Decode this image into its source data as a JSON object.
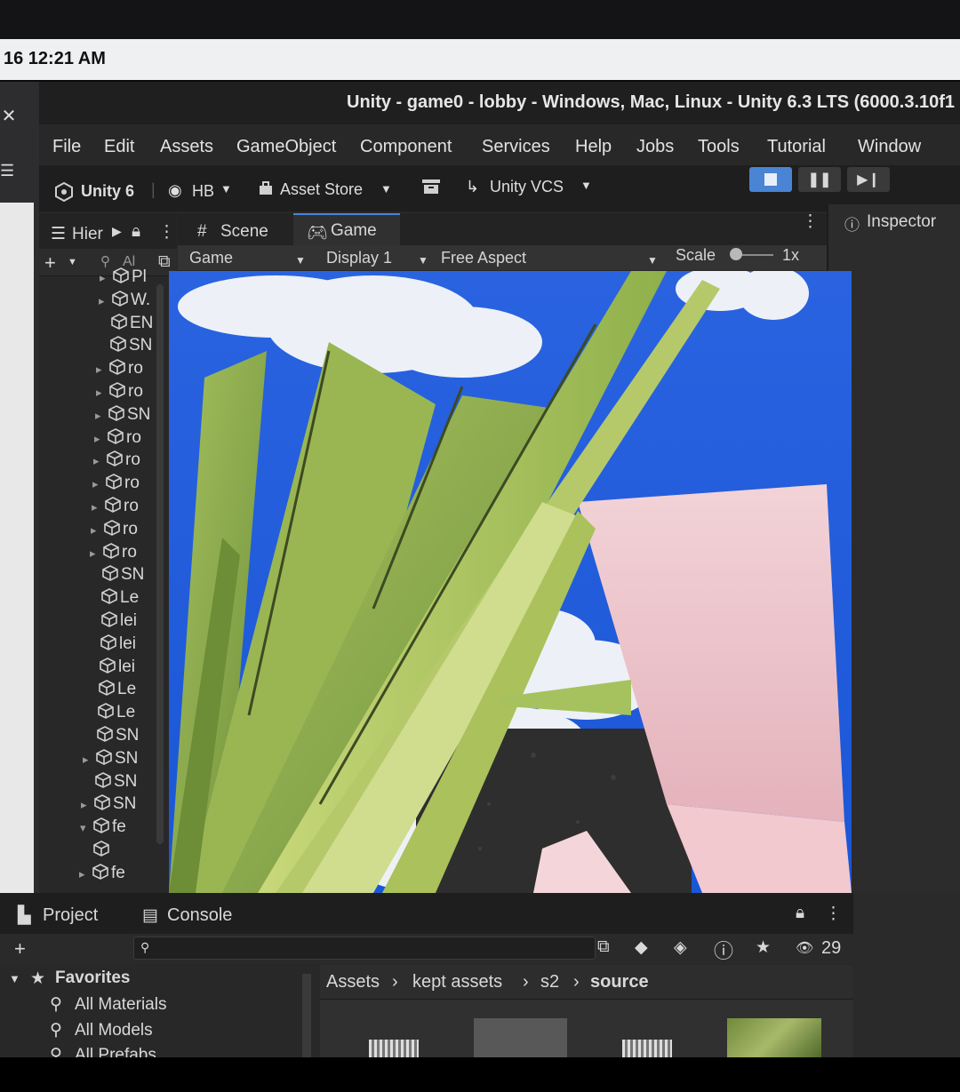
{
  "system": {
    "time": "16  12:21 AM"
  },
  "window": {
    "title": "Unity - game0 - lobby - Windows, Mac, Linux - Unity 6.3 LTS (6000.3.10f1"
  },
  "menu": [
    "File",
    "Edit",
    "Assets",
    "GameObject",
    "Component",
    "Services",
    "Help",
    "Jobs",
    "Tools",
    "Tutorial",
    "Window"
  ],
  "toolbar": {
    "unity_label": "Unity 6",
    "account_label": "HB",
    "asset_store_label": "Asset Store",
    "vcs_label": "Unity VCS"
  },
  "hierarchy": {
    "tab_label": "Hier",
    "search_placeholder": "Al",
    "rows": [
      {
        "label": "Pl",
        "expand": "▸"
      },
      {
        "label": "W.",
        "expand": "▸"
      },
      {
        "label": "EN",
        "expand": ""
      },
      {
        "label": "SN",
        "expand": ""
      },
      {
        "label": "ro",
        "expand": "▸"
      },
      {
        "label": "ro",
        "expand": "▸"
      },
      {
        "label": "SN",
        "expand": "▸"
      },
      {
        "label": "ro",
        "expand": "▸"
      },
      {
        "label": "ro",
        "expand": "▸"
      },
      {
        "label": "ro",
        "expand": "▸"
      },
      {
        "label": "ro",
        "expand": "▸"
      },
      {
        "label": "ro",
        "expand": "▸"
      },
      {
        "label": "ro",
        "expand": "▸"
      },
      {
        "label": "SN",
        "expand": ""
      },
      {
        "label": "Le",
        "expand": ""
      },
      {
        "label": "lei",
        "expand": ""
      },
      {
        "label": "lei",
        "expand": ""
      },
      {
        "label": "lei",
        "expand": ""
      },
      {
        "label": "Le",
        "expand": ""
      },
      {
        "label": "Le",
        "expand": ""
      },
      {
        "label": "SN",
        "expand": ""
      },
      {
        "label": "SN",
        "expand": "▸"
      },
      {
        "label": "SN",
        "expand": ""
      },
      {
        "label": "SN",
        "expand": "▸"
      },
      {
        "label": "fe",
        "expand": "▾"
      },
      {
        "label": "",
        "expand": ""
      },
      {
        "label": "fe",
        "expand": "▸"
      }
    ]
  },
  "game_view": {
    "tabs": [
      "Scene",
      "Game"
    ],
    "active_tab": "Game",
    "view_mode": "Game",
    "display": "Display 1",
    "aspect": "Free Aspect",
    "scale_label": "Scale",
    "scale_value": "1x"
  },
  "inspector": {
    "tab_label": "Inspector"
  },
  "project": {
    "tabs": [
      "Project",
      "Console"
    ],
    "hidden_count": "29",
    "favorites_label": "Favorites",
    "favorites": [
      "All Materials",
      "All Models",
      "All Prefabs"
    ],
    "breadcrumb": [
      "Assets",
      "kept assets",
      "s2",
      "source"
    ]
  },
  "colors": {
    "accent_blue": "#4a84d4",
    "panel_bg": "#282828",
    "sky": "#1d5fe0",
    "leaf": "#8fb04a"
  }
}
